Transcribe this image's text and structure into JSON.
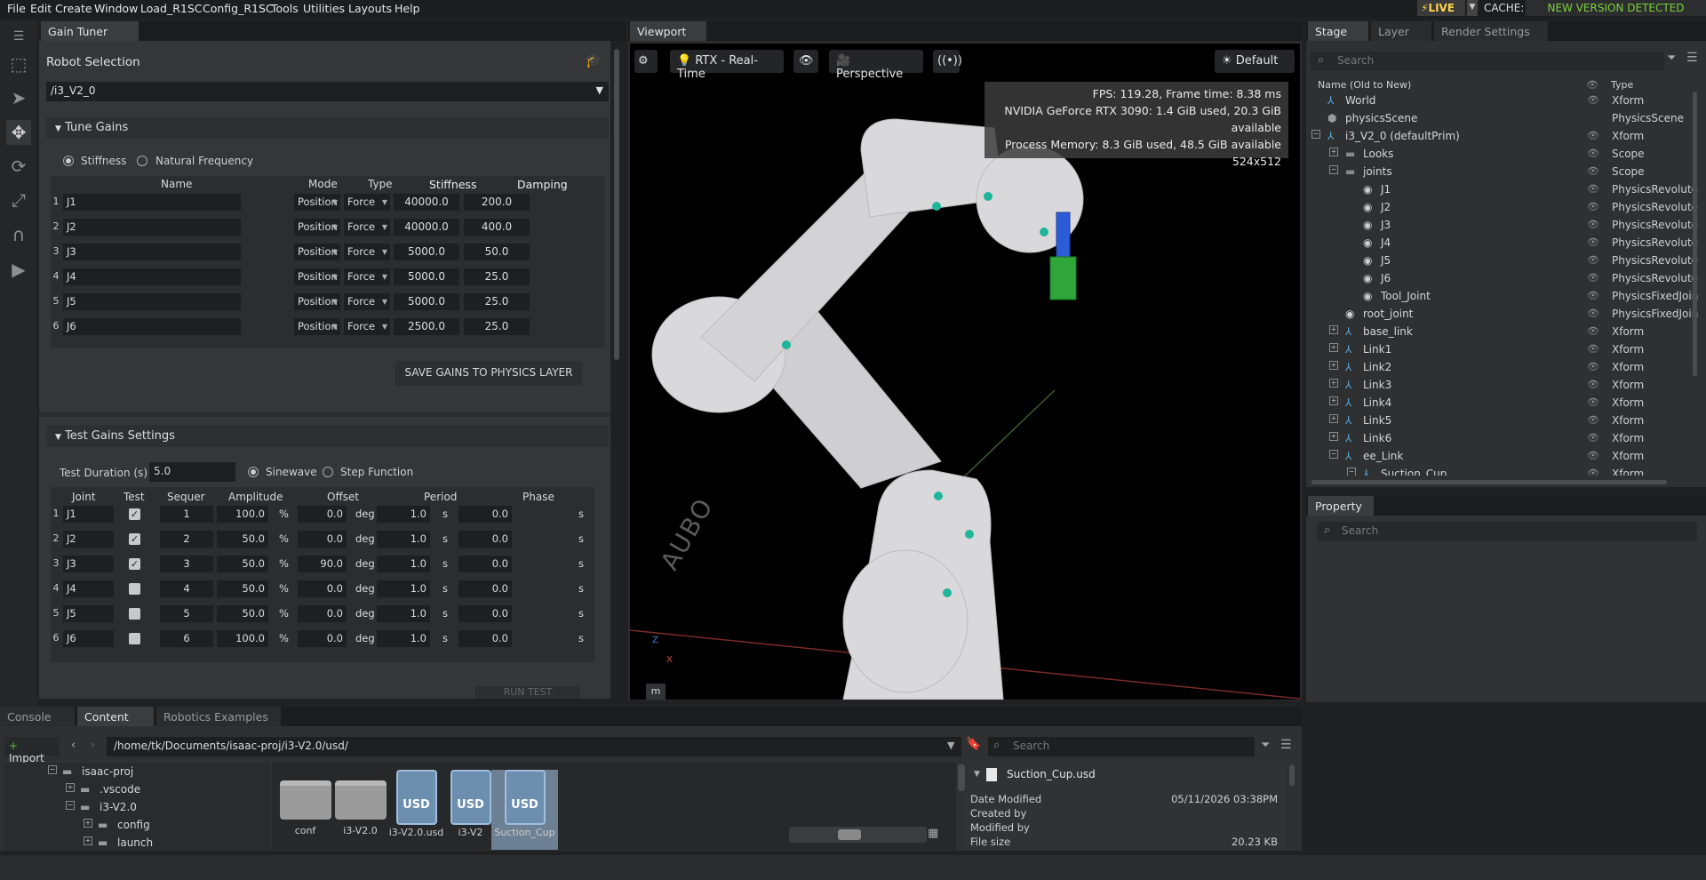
{
  "menubar": {
    "items": [
      "File",
      "Edit",
      "Create",
      "Window",
      "Load_R1SC",
      "Config_R1SC",
      "Tools",
      "Utilities",
      "Layouts",
      "Help"
    ],
    "live": "LIVE",
    "cache": "CACHE:",
    "new_version": "NEW VERSION DETECTED"
  },
  "gain_tuner": {
    "tab": "Gain Tuner",
    "robot_selection_label": "Robot Selection",
    "robot_value": "/i3_V2_0",
    "tune_gains_label": "Tune Gains",
    "radio_stiffness": "Stiffness",
    "radio_natural": "Natural Frequency",
    "columns": [
      "Name",
      "Mode",
      "Type",
      "Stiffness",
      "Damping"
    ],
    "rows": [
      {
        "n": "1",
        "name": "J1",
        "mode": "Position",
        "type": "Force",
        "stiffness": "40000.0",
        "damping": "200.0"
      },
      {
        "n": "2",
        "name": "J2",
        "mode": "Position",
        "type": "Force",
        "stiffness": "40000.0",
        "damping": "400.0"
      },
      {
        "n": "3",
        "name": "J3",
        "mode": "Position",
        "type": "Force",
        "stiffness": "5000.0",
        "damping": "50.0"
      },
      {
        "n": "4",
        "name": "J4",
        "mode": "Position",
        "type": "Force",
        "stiffness": "5000.0",
        "damping": "25.0"
      },
      {
        "n": "5",
        "name": "J5",
        "mode": "Position",
        "type": "Force",
        "stiffness": "5000.0",
        "damping": "25.0"
      },
      {
        "n": "6",
        "name": "J6",
        "mode": "Position",
        "type": "Force",
        "stiffness": "2500.0",
        "damping": "25.0"
      }
    ],
    "save_button": "SAVE GAINS TO PHYSICS LAYER",
    "test_label": "Test Gains Settings",
    "duration_label": "Test Duration (s)",
    "duration_value": "5.0",
    "radio_sine": "Sinewave",
    "radio_step": "Step Function",
    "test_columns": [
      "Joint",
      "Test",
      "Sequer",
      "Amplitude",
      "Offset",
      "Period",
      "Phase"
    ],
    "test_rows": [
      {
        "n": "1",
        "joint": "J1",
        "checked": true,
        "seq": "1",
        "amp": "100.0",
        "amp_u": "%",
        "off": "0.0",
        "off_u": "deg",
        "per": "1.0",
        "per_u": "s",
        "ph": "0.0",
        "ph_u": "s"
      },
      {
        "n": "2",
        "joint": "J2",
        "checked": true,
        "seq": "2",
        "amp": "50.0",
        "amp_u": "%",
        "off": "0.0",
        "off_u": "deg",
        "per": "1.0",
        "per_u": "s",
        "ph": "0.0",
        "ph_u": "s"
      },
      {
        "n": "3",
        "joint": "J3",
        "checked": true,
        "seq": "3",
        "amp": "50.0",
        "amp_u": "%",
        "off": "90.0",
        "off_u": "deg",
        "per": "1.0",
        "per_u": "s",
        "ph": "0.0",
        "ph_u": "s"
      },
      {
        "n": "4",
        "joint": "J4",
        "checked": false,
        "seq": "4",
        "amp": "50.0",
        "amp_u": "%",
        "off": "0.0",
        "off_u": "deg",
        "per": "1.0",
        "per_u": "s",
        "ph": "0.0",
        "ph_u": "s"
      },
      {
        "n": "5",
        "joint": "J5",
        "checked": false,
        "seq": "5",
        "amp": "50.0",
        "amp_u": "%",
        "off": "0.0",
        "off_u": "deg",
        "per": "1.0",
        "per_u": "s",
        "ph": "0.0",
        "ph_u": "s"
      },
      {
        "n": "6",
        "joint": "J6",
        "checked": false,
        "seq": "6",
        "amp": "100.0",
        "amp_u": "%",
        "off": "0.0",
        "off_u": "deg",
        "per": "1.0",
        "per_u": "s",
        "ph": "0.0",
        "ph_u": "s"
      }
    ],
    "run_test": "RUN TEST"
  },
  "viewport": {
    "tab": "Viewport",
    "render_mode": "RTX - Real-Time",
    "camera": "Perspective",
    "lighting": "Default",
    "stats": [
      "FPS: 119.28, Frame time: 8.38 ms",
      "NVIDIA GeForce RTX 3090: 1.4 GiB used, 20.3 GiB available",
      "Process Memory: 8.3 GiB used, 48.5 GiB available",
      "524x512"
    ],
    "axis_z": "Z",
    "axis_x": "X",
    "units": "m",
    "robot_text": "AUBO"
  },
  "stage": {
    "tabs": [
      "Stage",
      "Layer",
      "Render Settings"
    ],
    "search_placeholder": "Search",
    "col_name": "Name (Old to New)",
    "col_type": "Type",
    "items": [
      {
        "label": "World",
        "type": "Xform",
        "depth": 1
      },
      {
        "label": "physicsScene",
        "type": "PhysicsScene",
        "depth": 1
      },
      {
        "label": "i3_V2_0 (defaultPrim)",
        "type": "Xform",
        "depth": 1
      },
      {
        "label": "Looks",
        "type": "Scope",
        "depth": 2
      },
      {
        "label": "joints",
        "type": "Scope",
        "depth": 2
      },
      {
        "label": "J1",
        "type": "PhysicsRevolute",
        "depth": 3
      },
      {
        "label": "J2",
        "type": "PhysicsRevolute",
        "depth": 3
      },
      {
        "label": "J3",
        "type": "PhysicsRevolute",
        "depth": 3
      },
      {
        "label": "J4",
        "type": "PhysicsRevolute",
        "depth": 3
      },
      {
        "label": "J5",
        "type": "PhysicsRevolute",
        "depth": 3
      },
      {
        "label": "J6",
        "type": "PhysicsRevolute",
        "depth": 3
      },
      {
        "label": "Tool_Joint",
        "type": "PhysicsFixedJoin",
        "depth": 3
      },
      {
        "label": "root_joint",
        "type": "PhysicsFixedJoin",
        "depth": 2
      },
      {
        "label": "base_link",
        "type": "Xform",
        "depth": 2
      },
      {
        "label": "Link1",
        "type": "Xform",
        "depth": 2
      },
      {
        "label": "Link2",
        "type": "Xform",
        "depth": 2
      },
      {
        "label": "Link3",
        "type": "Xform",
        "depth": 2
      },
      {
        "label": "Link4",
        "type": "Xform",
        "depth": 2
      },
      {
        "label": "Link5",
        "type": "Xform",
        "depth": 2
      },
      {
        "label": "Link6",
        "type": "Xform",
        "depth": 2
      },
      {
        "label": "ee_Link",
        "type": "Xform",
        "depth": 2
      },
      {
        "label": "Suction_Cup",
        "type": "Xform",
        "depth": 3
      }
    ]
  },
  "property": {
    "tab": "Property",
    "search_placeholder": "Search"
  },
  "content": {
    "tabs": [
      "Console",
      "Content",
      "Robotics Examples"
    ],
    "import": "Import",
    "path": "/home/tk/Documents/isaac-proj/i3-V2.0/usd/",
    "search_placeholder": "Search",
    "tree": [
      "isaac-proj",
      ".vscode",
      "i3-V2.0",
      "config",
      "launch"
    ],
    "files": [
      {
        "name": "conf",
        "kind": "folder"
      },
      {
        "name": "i3-V2.0",
        "kind": "folder"
      },
      {
        "name": "i3-V2.0.usd",
        "kind": "usd"
      },
      {
        "name": "i3-V2",
        "kind": "usd"
      },
      {
        "name": "Suction_Cup",
        "kind": "usd"
      }
    ],
    "detail_title": "Suction_Cup.usd",
    "detail": [
      {
        "k": "Date Modified",
        "v": "05/11/2026 03:38PM"
      },
      {
        "k": "Created by",
        "v": ""
      },
      {
        "k": "Modified by",
        "v": ""
      },
      {
        "k": "File size",
        "v": "20.23 KB"
      }
    ]
  }
}
